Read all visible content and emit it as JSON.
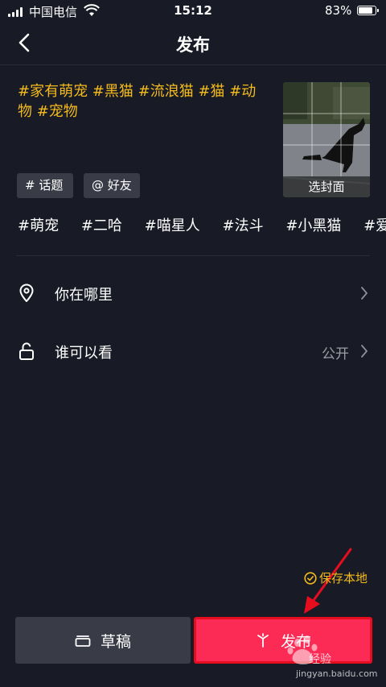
{
  "status_bar": {
    "carrier": "中国电信",
    "time": "15:12",
    "battery_pct": "83%",
    "battery_level": 0.83
  },
  "nav": {
    "title": "发布",
    "back_icon": "chevron-left-icon"
  },
  "caption": "#家有萌宠 #黑猫 #流浪猫 #猫 #动物 #宠物",
  "cover": {
    "label": "选封面"
  },
  "chips": {
    "topic": "话题",
    "friend": "好友",
    "topic_symbol": "#",
    "friend_symbol": "@"
  },
  "tags": [
    "#萌宠",
    "#二哈",
    "#喵星人",
    "#法斗",
    "#小黑猫",
    "#爱护"
  ],
  "rows": {
    "location": {
      "label": "你在哪里",
      "icon": "location-pin-icon"
    },
    "visibility": {
      "label": "谁可以看",
      "value": "公开",
      "icon": "unlock-icon"
    }
  },
  "save_local": "保存本地",
  "buttons": {
    "draft": "草稿",
    "publish": "发布"
  },
  "watermark": {
    "text": "经验",
    "url": "jingyan.baidu.com"
  },
  "colors": {
    "accent": "#f3bb1c",
    "publish": "#fc2b55",
    "background": "#181a26",
    "highlight": "#e60e1e"
  }
}
